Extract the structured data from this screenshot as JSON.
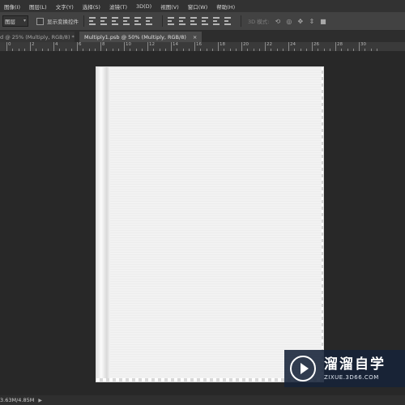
{
  "menubar": {
    "items": [
      "图像(I)",
      "图层(L)",
      "文字(Y)",
      "选择(S)",
      "滤镜(T)",
      "3D(D)",
      "视图(V)",
      "窗口(W)",
      "帮助(H)"
    ]
  },
  "options": {
    "layer_select": "图层",
    "show_transform_label": "显示变换控件",
    "mode_3d_label": "3D 模式:"
  },
  "tabs": [
    {
      "label": "d @ 25% (Multiply, RGB/8) *",
      "close": "×"
    },
    {
      "label": "Multiply1.psb @ 50% (Multiply, RGB/8)",
      "close": "×"
    }
  ],
  "ruler": {
    "labels": [
      "0",
      "2",
      "4",
      "6",
      "8",
      "10",
      "12",
      "14",
      "16",
      "18",
      "20",
      "22",
      "24",
      "26",
      "28",
      "30"
    ]
  },
  "status": {
    "doc_size": "3.63M/4.85M"
  },
  "watermark": {
    "title": "溜溜自学",
    "url": "ZIXUE.3D66.COM"
  },
  "colors": {
    "menubar_bg": "#323232",
    "options_bg": "#424242",
    "canvas_bg": "#282828",
    "document": "#f2f2f2",
    "watermark_bg": "#162238"
  }
}
